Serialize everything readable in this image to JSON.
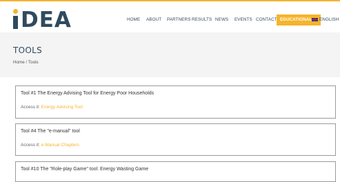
{
  "brand": {
    "logo_rest": "DEA"
  },
  "nav": {
    "items": [
      "HOME",
      "ABOUT",
      "PARTNERS",
      "RESULTS",
      "NEWS",
      "EVENTS",
      "CONTACT"
    ],
    "educational": "EDUCATIONAL",
    "language": "ENGLISH"
  },
  "page": {
    "title": "TOOLS",
    "breadcrumb": "Home / Tools"
  },
  "tools": [
    {
      "title": "Tool #1 The Energy Advising Tool for Energy Poor Households",
      "access_label": "Access it:",
      "link": "Energy Advising Tool"
    },
    {
      "title": "Tool #4 The \"e-manual\" tool",
      "access_label": "Access it:",
      "link": "e-Manual Chapters"
    },
    {
      "title": "Tool #10 The \"Role-play Game\" tool: Energy Wasting Game"
    }
  ],
  "colors": {
    "accent": "#f5b42d",
    "brand": "#2f4a5e"
  }
}
